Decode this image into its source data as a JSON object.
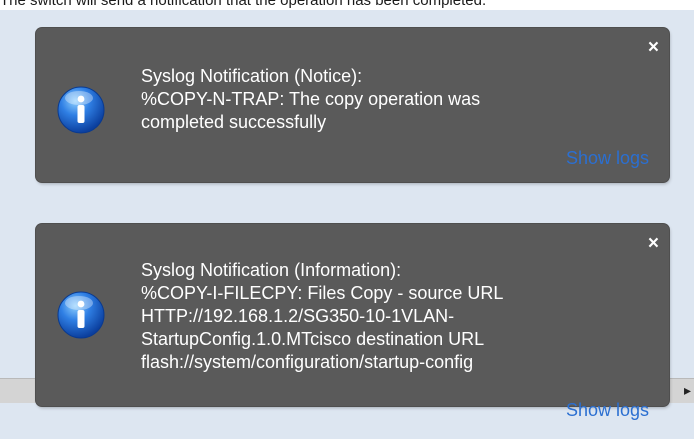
{
  "caption": "The switch will send a notification that the operation has been completed.",
  "notifications": [
    {
      "title": "Syslog Notification (Notice):",
      "lines": [
        "%COPY-N-TRAP: The copy operation was",
        "completed successfully"
      ],
      "close": "×",
      "link": "Show logs",
      "icon": "info-icon"
    },
    {
      "title": "Syslog Notification (Information):",
      "lines": [
        "%COPY-I-FILECPY: Files Copy - source URL",
        "HTTP://192.168.1.2/SG350-10-1VLAN-",
        "StartupConfig.1.0.MTcisco destination URL",
        "flash://system/configuration/startup-config"
      ],
      "close": "×",
      "link": "Show logs",
      "icon": "info-icon"
    }
  ],
  "scroll_arrow": "▸",
  "colors": {
    "toast_bg": "#5a5a5a",
    "page_bg": "#dde6f1",
    "link": "#2b6fd1",
    "icon_blue": "#1f5fc6"
  }
}
